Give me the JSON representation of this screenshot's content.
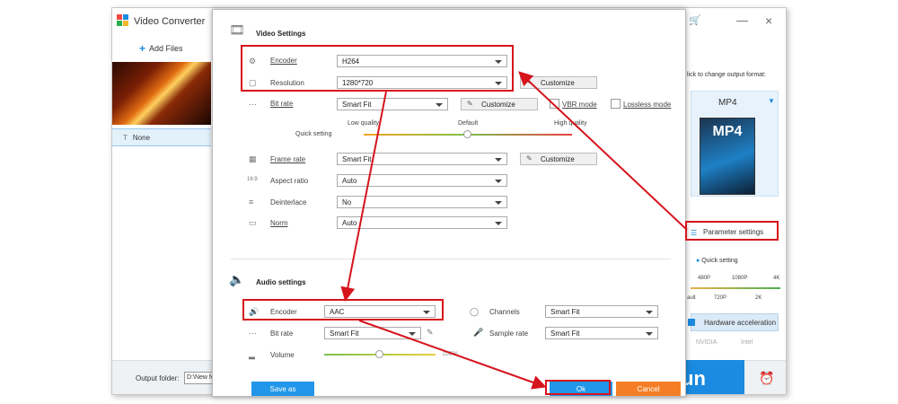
{
  "app": {
    "title": "Video Converter",
    "add_files": "Add Files",
    "subtitle_value": "None",
    "output_folder_label": "Output folder:",
    "output_folder_value": "D:\\New fo",
    "run_label": "un",
    "click_to_change": "lick to change output format:",
    "format_name": "MP4",
    "format_icon_label": "MP4",
    "parameter_settings": "Parameter settings",
    "quick_setting": "Quick setting",
    "quick_ticks_top": [
      "480P",
      "1080P",
      "4K"
    ],
    "quick_ticks_bottom": [
      "ault",
      "720P",
      "2K"
    ],
    "hardware_acceleration": "Hardware acceleration",
    "gpu_brands": [
      "NVIDIA",
      "Intel"
    ]
  },
  "video": {
    "section_title": "Video Settings",
    "encoder_label": "Encoder",
    "encoder_value": "H264",
    "resolution_label": "Resolution",
    "resolution_value": "1280*720",
    "resolution_customize": "Customize",
    "bitrate_label": "Bit rate",
    "bitrate_value": "Smart Fit",
    "bitrate_customize": "Customize",
    "vbr_label": "VBR mode",
    "lossless_label": "Lossless mode",
    "quick_setting_label": "Quick setting",
    "quality_low": "Low quality",
    "quality_default": "Default",
    "quality_high": "High quality",
    "quality_level": 0.5,
    "framerate_label": "Frame rate",
    "framerate_value": "Smart Fit",
    "framerate_customize": "Customize",
    "aspect_label": "Aspect ratio",
    "aspect_value": "Auto",
    "deinterlace_label": "Deinterlace",
    "deinterlace_value": "No",
    "norm_label": "Norm",
    "norm_value": "Auto"
  },
  "audio": {
    "section_title": "Audio settings",
    "encoder_label": "Encoder",
    "encoder_value": "AAC",
    "channels_label": "Channels",
    "channels_value": "Smart Fit",
    "bitrate_label": "Bit rate",
    "bitrate_value": "Smart Fit",
    "samplerate_label": "Sample rate",
    "samplerate_value": "Smart Fit",
    "volume_label": "Volume",
    "volume_value": "100%",
    "volume_level": 0.5
  },
  "buttons": {
    "save_as": "Save as",
    "ok": "Ok",
    "cancel": "Cancel"
  },
  "colors": {
    "accent": "#2296e8",
    "cancel": "#f47e25",
    "annotation": "#d6141c"
  }
}
